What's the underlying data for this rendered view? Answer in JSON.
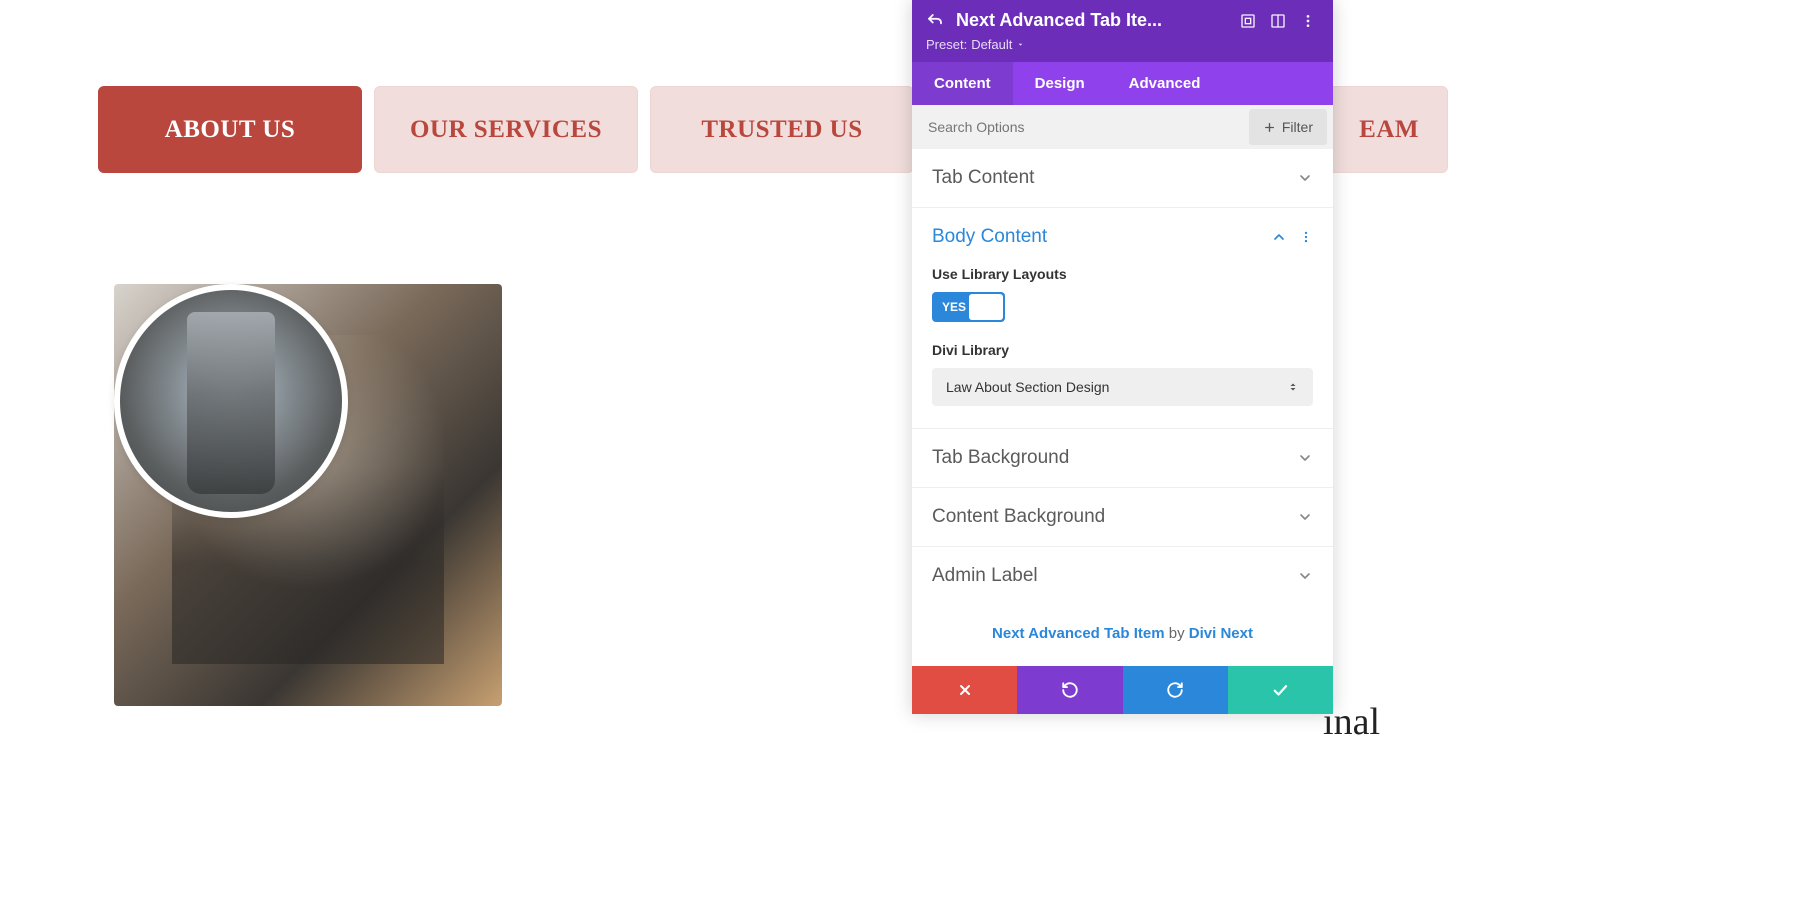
{
  "tabs": {
    "about": "ABOUT US",
    "services": "OUR SERVICES",
    "trusted": "TRUSTED US",
    "team": "EAM"
  },
  "truncated_word": "inal",
  "panel": {
    "title": "Next Advanced Tab Ite...",
    "preset_label": "Preset:",
    "preset_value": "Default",
    "tabs": {
      "content": "Content",
      "design": "Design",
      "advanced": "Advanced"
    },
    "search_placeholder": "Search Options",
    "filter_label": "Filter",
    "sections": {
      "tab_content": "Tab Content",
      "body_content": "Body Content",
      "tab_background": "Tab Background",
      "content_background": "Content Background",
      "admin_label": "Admin Label"
    },
    "body": {
      "use_library_label": "Use Library Layouts",
      "toggle_value": "YES",
      "divi_library_label": "Divi Library",
      "divi_library_value": "Law About Section Design"
    },
    "credit": {
      "module": "Next Advanced Tab Item",
      "by": " by ",
      "author": "Divi Next"
    }
  }
}
